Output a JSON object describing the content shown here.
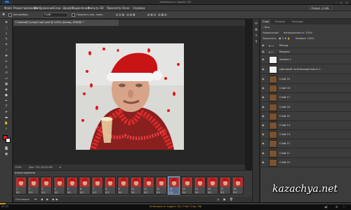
{
  "titlebar": {
    "app_badge": "PS",
    "title": "Анимация от Аддикт (Ес",
    "controls": [
      "–",
      "▫",
      "×"
    ]
  },
  "menu": {
    "items": [
      "Файл",
      "Редактирование",
      "Изображение",
      "Слои",
      "Шрифт",
      "Выделение",
      "Фильтр",
      "3D",
      "Просмотр",
      "Окно",
      "Справка"
    ],
    "workspace": "Новые слайс"
  },
  "options": {
    "autoselect_label": "Автовыбор:",
    "autoselect_value": "Слой",
    "show_controls_label": "Показать упр. элем."
  },
  "document": {
    "tab_label": "Гневный(Гуляр)Стар2.psd @ 100% (Холод, RGB/8) *",
    "zoom": "100%",
    "doc_size": "Док: 391,2K/10,6M"
  },
  "timeline": {
    "header": "Шкала времени",
    "loop_label": "Постоянно",
    "frames": [
      {
        "num": "1",
        "dur": "0,1"
      },
      {
        "num": "2",
        "dur": "0,1"
      },
      {
        "num": "3",
        "dur": "0,1"
      },
      {
        "num": "4",
        "dur": "0,1"
      },
      {
        "num": "5",
        "dur": "0,1"
      },
      {
        "num": "6",
        "dur": "0,1"
      },
      {
        "num": "7",
        "dur": "0,1"
      },
      {
        "num": "8",
        "dur": "0,1"
      },
      {
        "num": "9",
        "dur": "0,1"
      },
      {
        "num": "10",
        "dur": "0,1"
      },
      {
        "num": "11",
        "dur": "0,1"
      },
      {
        "num": "12",
        "dur": "0,1"
      },
      {
        "num": "13",
        "dur": "0,1"
      },
      {
        "num": "14",
        "dur": "0,1"
      },
      {
        "num": "15",
        "dur": "0,1"
      },
      {
        "num": "16",
        "dur": "0,1"
      },
      {
        "num": "17",
        "dur": "0,1"
      },
      {
        "num": "18",
        "dur": "0,1"
      }
    ]
  },
  "panel": {
    "tabs": [
      "Слои",
      "Каналы",
      "Контуры"
    ],
    "search_label": "Вид",
    "blend_label": "Нормальный",
    "opacity_label": "Непрозрачность: 100%",
    "lock_label": "Закрепить:",
    "fill_label": "Заливка: 100%",
    "groups": [
      "Метод",
      "Модели"
    ],
    "special_layers": [
      {
        "name": "Уровни 1",
        "thumb": "white"
      },
      {
        "name": "Цветовой тон/Насыщенность 1",
        "thumb": "white"
      }
    ],
    "layers": [
      "Слой 19",
      "Слой 18",
      "Слой 17",
      "Слой 16",
      "Слой 15",
      "Слой 14",
      "Слой 13",
      "Слой 12",
      "Слой 11",
      "Слой 10"
    ]
  },
  "player": {
    "time": "00:00",
    "caption": "Анимация от Аддикт (Ес) Гнев Стар. Эф"
  },
  "watermark": "kazachya.net"
}
